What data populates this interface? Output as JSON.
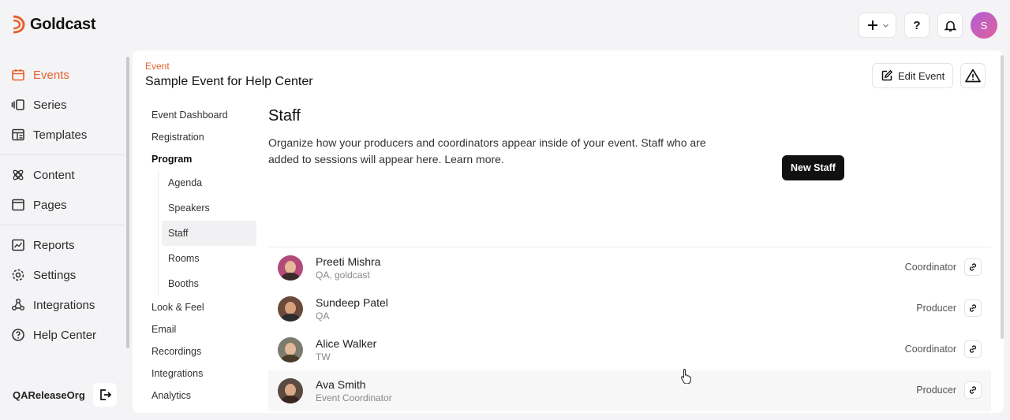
{
  "brand": {
    "name": "Goldcast",
    "accent": "#e7602a"
  },
  "topbar": {
    "add_icon": "plus-icon",
    "help_label": "?",
    "notification_icon": "bell-icon",
    "user_initial": "S"
  },
  "leftnav": {
    "groups": [
      [
        {
          "label": "Events",
          "icon": "calendar-icon",
          "active": true
        },
        {
          "label": "Series",
          "icon": "series-icon"
        },
        {
          "label": "Templates",
          "icon": "templates-icon"
        }
      ],
      [
        {
          "label": "Content",
          "icon": "content-icon"
        },
        {
          "label": "Pages",
          "icon": "pages-icon"
        }
      ],
      [
        {
          "label": "Reports",
          "icon": "reports-icon"
        },
        {
          "label": "Settings",
          "icon": "gear-icon"
        },
        {
          "label": "Integrations",
          "icon": "integrations-icon"
        },
        {
          "label": "Help Center",
          "icon": "help-icon"
        }
      ]
    ],
    "org_name": "QAReleaseOrg"
  },
  "event": {
    "eyebrow": "Event",
    "title": "Sample Event for Help Center",
    "edit_label": "Edit Event"
  },
  "subnav": {
    "items": [
      "Event Dashboard",
      "Registration"
    ],
    "program_label": "Program",
    "program_children": [
      "Agenda",
      "Speakers",
      "Staff",
      "Rooms",
      "Booths"
    ],
    "selected_child": "Staff",
    "items_after": [
      "Look & Feel",
      "Email",
      "Recordings",
      "Integrations",
      "Analytics"
    ]
  },
  "content": {
    "title": "Staff",
    "description": "Organize how your producers and coordinators appear inside of your event. Staff who are added to sessions will appear here. Learn more.",
    "new_staff_label": "New Staff"
  },
  "staff": [
    {
      "name": "Preeti Mishra",
      "sub": "QA, goldcast",
      "role": "Coordinator",
      "avatar_colors": [
        "#b24a7a",
        "#3a2a2a"
      ]
    },
    {
      "name": "Sundeep Patel",
      "sub": "QA",
      "role": "Producer",
      "avatar_colors": [
        "#6a4a3a",
        "#2c2c2c"
      ]
    },
    {
      "name": "Alice Walker",
      "sub": "TW",
      "role": "Coordinator",
      "avatar_colors": [
        "#7d7a6e",
        "#4a3a2a"
      ]
    },
    {
      "name": "Ava Smith",
      "sub": "Event Coordinator",
      "role": "Producer",
      "avatar_colors": [
        "#5a4a40",
        "#3a2620"
      ]
    }
  ]
}
